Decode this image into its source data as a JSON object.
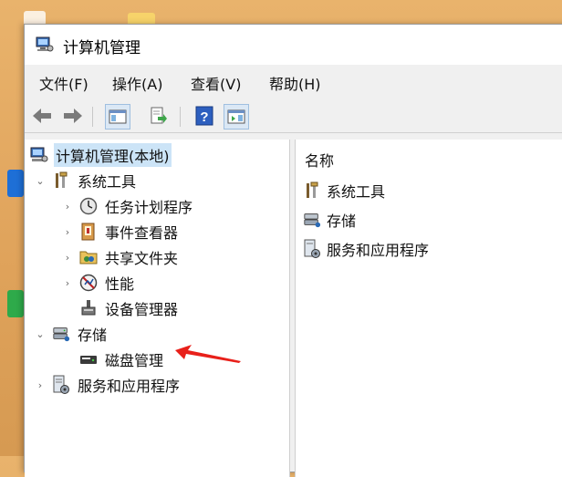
{
  "window": {
    "title": "计算机管理"
  },
  "menu": [
    {
      "label": "文件(F)"
    },
    {
      "label": "操作(A)"
    },
    {
      "label": "查看(V)"
    },
    {
      "label": "帮助(H)"
    }
  ],
  "toolbar": {
    "buttons": [
      "back-icon",
      "forward-icon",
      "show-tree-icon",
      "export-icon",
      "help-icon",
      "action-pane-icon"
    ]
  },
  "tree": {
    "root": "计算机管理(本地)",
    "system_tools": "系统工具",
    "task_scheduler": "任务计划程序",
    "event_viewer": "事件查看器",
    "shared_folders": "共享文件夹",
    "performance": "性能",
    "device_manager": "设备管理器",
    "storage": "存储",
    "disk_management": "磁盘管理",
    "services_apps": "服务和应用程序"
  },
  "list": {
    "header": "名称",
    "items": [
      "系统工具",
      "存储",
      "服务和应用程序"
    ]
  },
  "colors": {
    "selection": "#cce4f7",
    "annotation_arrow": "#e8201a"
  }
}
